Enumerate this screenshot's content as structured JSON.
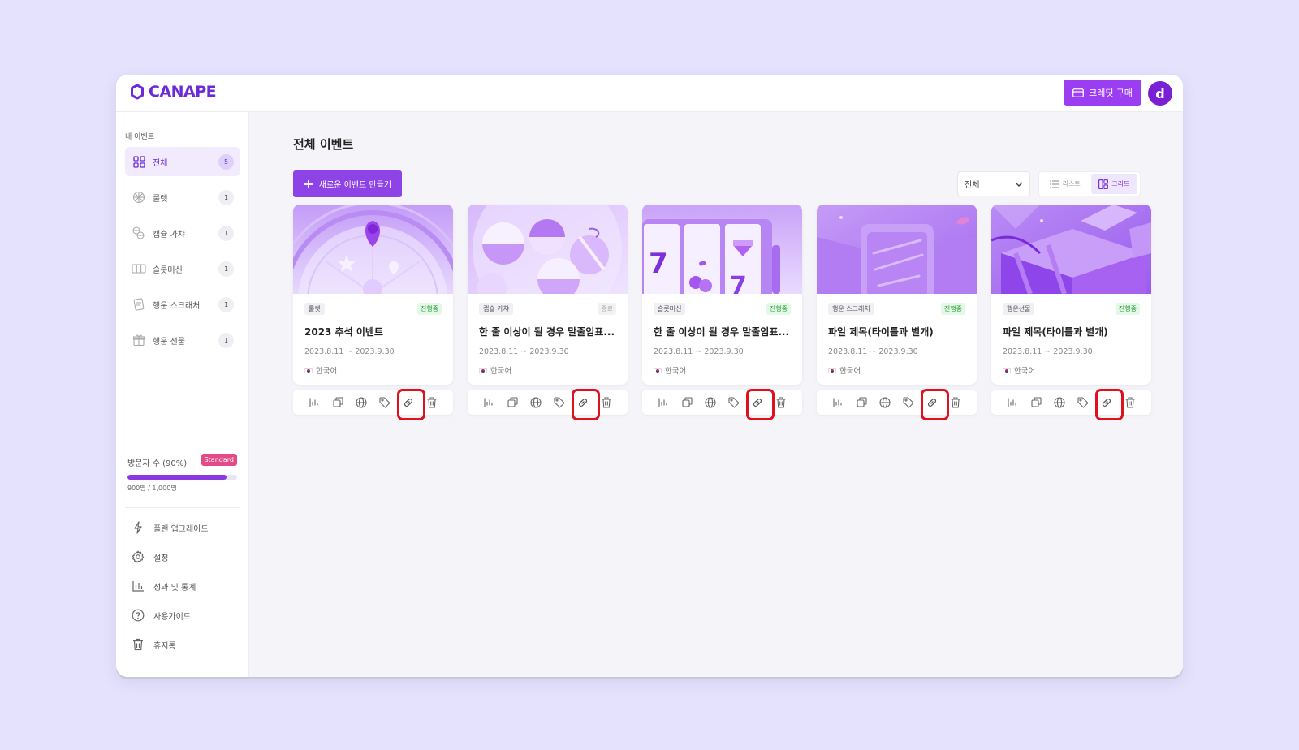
{
  "app": {
    "logo_text": "CANAPE",
    "credit_button": "크레딧 구매",
    "avatar_initial": "d",
    "brand_color": "#6c2bd9"
  },
  "sidebar": {
    "section_title": "내 이벤트",
    "items": [
      {
        "label": "전체",
        "count": "5",
        "icon": "grid-icon",
        "active": true
      },
      {
        "label": "룰렛",
        "count": "1",
        "icon": "roulette-icon"
      },
      {
        "label": "캡슐 가챠",
        "count": "1",
        "icon": "capsule-icon"
      },
      {
        "label": "슬롯머신",
        "count": "1",
        "icon": "slot-machine-icon"
      },
      {
        "label": "행운 스크래처",
        "count": "1",
        "icon": "scratcher-icon"
      },
      {
        "label": "행운 선물",
        "count": "1",
        "icon": "gift-icon"
      }
    ],
    "usage": {
      "label": "방문자 수 (90%)",
      "plan": "Standard",
      "percent": 90,
      "count_text": "900명 / 1,000명"
    },
    "menu": [
      {
        "label": "플랜 업그레이드",
        "icon": "lightning-icon"
      },
      {
        "label": "설정",
        "icon": "gear-icon"
      },
      {
        "label": "성과 및 통계",
        "icon": "bar-chart-icon"
      },
      {
        "label": "사용가이드",
        "icon": "help-icon"
      },
      {
        "label": "휴지통",
        "icon": "trash-icon"
      }
    ]
  },
  "main": {
    "title": "전체 이벤트",
    "new_button": "새로운 이벤트 만들기",
    "filter": "전체",
    "view": {
      "list": "리스트",
      "grid": "그리드",
      "active": "grid"
    },
    "cards": [
      {
        "type": "룰렛",
        "status": "진행중",
        "status_on": true,
        "title": "2023 추석 이벤트",
        "date": "2023.8.11 ~ 2023.9.30",
        "lang": "한국어"
      },
      {
        "type": "캡슐 가챠",
        "status": "종료",
        "status_on": false,
        "title": "한 줄 이상이 될 경우 말줄임표...",
        "date": "2023.8.11 ~ 2023.9.30",
        "lang": "한국어"
      },
      {
        "type": "슬롯머신",
        "status": "진행중",
        "status_on": true,
        "title": "한 줄 이상이 될 경우 말줄임표...",
        "date": "2023.8.11 ~ 2023.9.30",
        "lang": "한국어"
      },
      {
        "type": "행운 스크래처",
        "status": "진행중",
        "status_on": true,
        "title": "파일 제목(타이틀과 별개)",
        "date": "2023.8.11 ~ 2023.9.30",
        "lang": "한국어"
      },
      {
        "type": "행운선물",
        "status": "진행중",
        "status_on": true,
        "title": "파일 제목(타이틀과 별개)",
        "date": "2023.8.11 ~ 2023.9.30",
        "lang": "한국어"
      }
    ],
    "card_actions": [
      "stats-icon",
      "copy-icon",
      "globe-icon",
      "tag-icon",
      "link-icon",
      "trash-icon"
    ],
    "highlighted_action": "link-icon",
    "highlight_color": "#e0101c"
  }
}
